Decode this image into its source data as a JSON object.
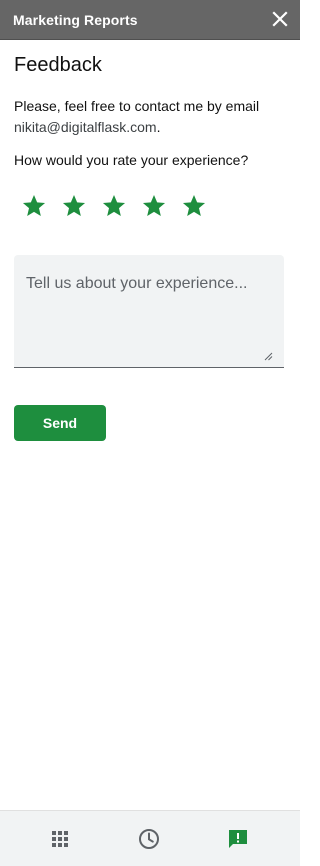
{
  "window": {
    "title": "Marketing Reports",
    "close_icon": "close-icon"
  },
  "feedback": {
    "heading": "Feedback",
    "intro_text": "Please, feel free to contact me by email",
    "email": "nikita@digitalflask.com",
    "email_suffix": ".",
    "rating_question": "How would you rate your experience?",
    "rating_max": 5,
    "rating_value": 5,
    "star_color": "#1e8e3e",
    "comment_placeholder": "Tell us about your experience...",
    "comment_value": "",
    "send_label": "Send",
    "send_color": "#1e8e3e"
  },
  "bottom_nav": {
    "items": [
      {
        "name": "apps",
        "icon": "grid-icon"
      },
      {
        "name": "history",
        "icon": "clock-icon"
      },
      {
        "name": "feedback",
        "icon": "feedback-icon",
        "active": true
      }
    ],
    "active_color": "#1e8e3e",
    "inactive_color": "#5f6368"
  }
}
